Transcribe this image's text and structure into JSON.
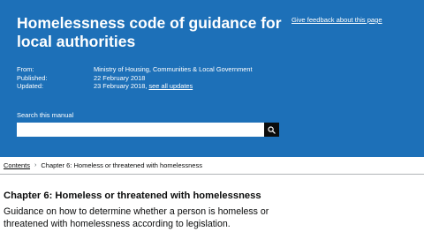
{
  "header": {
    "title": "Homelessness code of guidance for local authorities",
    "feedback_link": "Give feedback about this page"
  },
  "metadata": {
    "from_label": "From:",
    "from_value": "Ministry of Housing, Communities & Local Government",
    "published_label": "Published:",
    "published_value": "22 February 2018",
    "updated_label": "Updated:",
    "updated_value": "23 February 2018,",
    "see_all_updates": "see all updates"
  },
  "search": {
    "label": "Search this manual",
    "value": "",
    "button_icon": "search-icon"
  },
  "breadcrumb": {
    "root": "Contents",
    "separator_icon": "chevron-right-icon",
    "current": "Chapter 6: Homeless or threatened with homelessness"
  },
  "content": {
    "chapter_title": "Chapter 6: Homeless or threatened with homelessness",
    "description": "Guidance on how to determine whether a person is homeless or threatened with homelessness according to legislation."
  },
  "colors": {
    "banner_background": "#1d70b8",
    "text": "#0b0c0c",
    "divider": "#b1b4b6"
  }
}
